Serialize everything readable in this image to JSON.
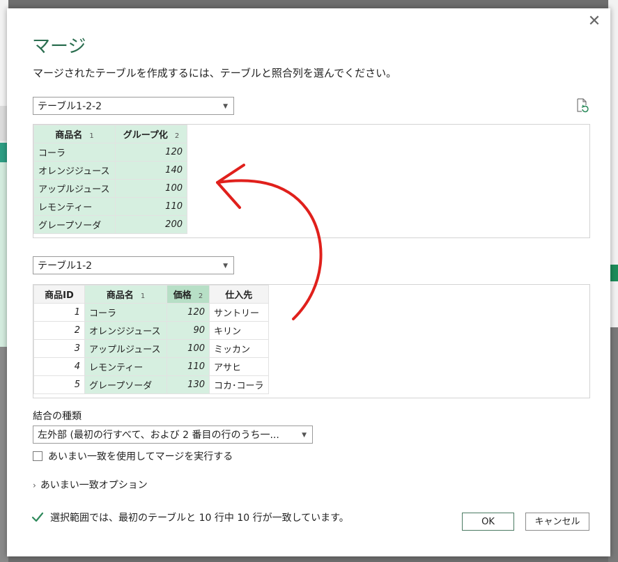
{
  "dialog": {
    "title": "マージ",
    "description": "マージされたテーブルを作成するには、テーブルと照合列を選んでください。",
    "close_icon": "close-icon"
  },
  "table1": {
    "selected": "テーブル1-2-2",
    "headers": [
      {
        "label": "商品名",
        "order": "1"
      },
      {
        "label": "グループ化",
        "order": "2"
      }
    ],
    "rows": [
      [
        "コーラ",
        "120"
      ],
      [
        "オレンジジュース",
        "140"
      ],
      [
        "アップルジュース",
        "100"
      ],
      [
        "レモンティー",
        "110"
      ],
      [
        "グレープソーダ",
        "200"
      ]
    ]
  },
  "table2": {
    "selected": "テーブル1-2",
    "headers": [
      {
        "label": "商品ID",
        "order": ""
      },
      {
        "label": "商品名",
        "order": "1"
      },
      {
        "label": "価格",
        "order": "2"
      },
      {
        "label": "仕入先",
        "order": ""
      }
    ],
    "rows": [
      [
        "1",
        "コーラ",
        "120",
        "サントリー"
      ],
      [
        "2",
        "オレンジジュース",
        "90",
        "キリン"
      ],
      [
        "3",
        "アップルジュース",
        "100",
        "ミッカン"
      ],
      [
        "4",
        "レモンティー",
        "110",
        "アサヒ"
      ],
      [
        "5",
        "グレープソーダ",
        "130",
        "コカ･コーラ"
      ]
    ]
  },
  "join": {
    "label": "結合の種類",
    "selected": "左外部 (最初の行すべて、および 2 番目の行のうち一..."
  },
  "fuzzy": {
    "checkbox_label": "あいまい一致を使用してマージを実行する",
    "options_label": "あいまい一致オプション"
  },
  "status": {
    "text": "選択範囲では、最初のテーブルと 10 行中 10 行が一致しています。"
  },
  "buttons": {
    "ok": "OK",
    "cancel": "キャンセル"
  },
  "colors": {
    "accent": "#2b6e50",
    "selected_column": "#d6efe0",
    "annotation": "#e0201c"
  }
}
